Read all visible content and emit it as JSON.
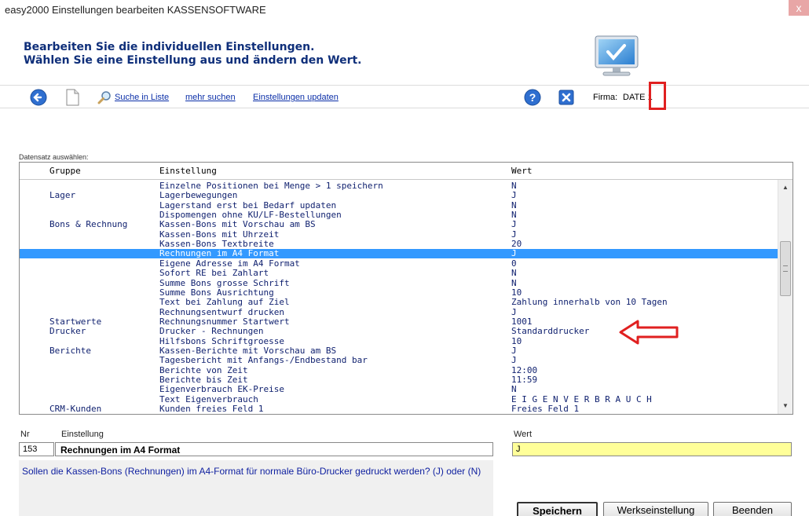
{
  "window": {
    "title": "easy2000 Einstellungen bearbeiten KASSENSOFTWARE",
    "close_label": "x"
  },
  "header": {
    "line1": "Bearbeiten Sie die individuellen Einstellungen.",
    "line2": "Wählen Sie eine Einstellung aus und ändern den Wert."
  },
  "toolbar": {
    "search_link": "Suche in Liste",
    "more_search_link": "mehr suchen",
    "update_link": "Einstellungen updaten",
    "firma_label": "Firma:",
    "firma_value": "DATE 1"
  },
  "list": {
    "caption": "Datensatz auswählen:",
    "columns": [
      "Gruppe",
      "Einstellung",
      "Wert"
    ],
    "selected_index": 7,
    "rows": [
      {
        "gruppe": "",
        "einstellung": "Einzelne Positionen bei Menge > 1 speichern",
        "wert": "N"
      },
      {
        "gruppe": "Lager",
        "einstellung": "Lagerbewegungen",
        "wert": "J"
      },
      {
        "gruppe": "",
        "einstellung": "Lagerstand erst bei Bedarf updaten",
        "wert": "N"
      },
      {
        "gruppe": "",
        "einstellung": "Dispomengen ohne KU/LF-Bestellungen",
        "wert": "N"
      },
      {
        "gruppe": "Bons & Rechnung",
        "einstellung": "Kassen-Bons mit Vorschau am BS",
        "wert": "J"
      },
      {
        "gruppe": "",
        "einstellung": "Kassen-Bons mit Uhrzeit",
        "wert": "J"
      },
      {
        "gruppe": "",
        "einstellung": "Kassen-Bons Textbreite",
        "wert": "20"
      },
      {
        "gruppe": "",
        "einstellung": "Rechnungen im A4 Format",
        "wert": "J"
      },
      {
        "gruppe": "",
        "einstellung": "Eigene Adresse im A4 Format",
        "wert": "0"
      },
      {
        "gruppe": "",
        "einstellung": "Sofort RE bei Zahlart",
        "wert": "N"
      },
      {
        "gruppe": "",
        "einstellung": "Summe Bons grosse Schrift",
        "wert": "N"
      },
      {
        "gruppe": "",
        "einstellung": "Summe Bons Ausrichtung",
        "wert": "10"
      },
      {
        "gruppe": "",
        "einstellung": "Text bei Zahlung auf Ziel",
        "wert": "Zahlung innerhalb von 10 Tagen"
      },
      {
        "gruppe": "",
        "einstellung": "Rechnungsentwurf drucken",
        "wert": "J"
      },
      {
        "gruppe": "Startwerte",
        "einstellung": "Rechnungsnummer Startwert",
        "wert": "1001"
      },
      {
        "gruppe": "Drucker",
        "einstellung": "Drucker - Rechnungen",
        "wert": "Standarddrucker"
      },
      {
        "gruppe": "",
        "einstellung": "Hilfsbons Schriftgroesse",
        "wert": "10"
      },
      {
        "gruppe": "Berichte",
        "einstellung": "Kassen-Berichte mit Vorschau am BS",
        "wert": "J"
      },
      {
        "gruppe": "",
        "einstellung": "Tagesbericht mit Anfangs-/Endbestand bar",
        "wert": "J"
      },
      {
        "gruppe": "",
        "einstellung": "Berichte von Zeit",
        "wert": "12:00"
      },
      {
        "gruppe": "",
        "einstellung": "Berichte bis Zeit",
        "wert": "11:59"
      },
      {
        "gruppe": "",
        "einstellung": "Eigenverbrauch EK-Preise",
        "wert": "N"
      },
      {
        "gruppe": "",
        "einstellung": "Text Eigenverbrauch",
        "wert": "E I G E N V E R B R A U C H"
      },
      {
        "gruppe": "CRM-Kunden",
        "einstellung": "Kunden freies Feld 1",
        "wert": "Freies Feld 1"
      }
    ]
  },
  "detail": {
    "nr_label": "Nr",
    "einstellung_label": "Einstellung",
    "wert_label": "Wert",
    "nr_value": "153",
    "einstellung_value": "Rechnungen im A4 Format",
    "wert_value": "J",
    "help_text": "Sollen die Kassen-Bons (Rechnungen) im A4-Format für normale Büro-Drucker gedruckt werden? (J) oder (N)"
  },
  "buttons": {
    "save": "Speichern",
    "factory": "Werkseinstellung",
    "exit": "Beenden"
  },
  "colors": {
    "selection": "#3399ff",
    "header_text": "#0f2f7a",
    "link": "#0b2fa8",
    "value_field": "#ffff99",
    "annotation_red": "#e02020"
  }
}
